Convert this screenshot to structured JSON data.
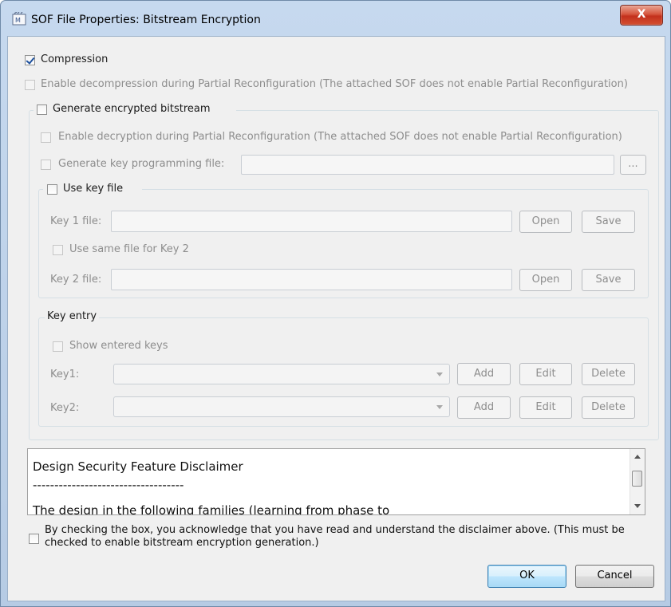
{
  "window": {
    "title": "SOF File Properties: Bitstream Encryption",
    "close_label": "X"
  },
  "compression": {
    "label": "Compression",
    "checked": true
  },
  "enable_decompression": {
    "label": "Enable decompression during Partial Reconfiguration (The attached SOF does not enable Partial Reconfiguration)",
    "checked": false,
    "enabled": false
  },
  "encrypted": {
    "label": "Generate encrypted bitstream",
    "checked": false,
    "enable_decryption_label": "Enable decryption during Partial Reconfiguration (The attached SOF does not enable Partial Reconfiguration)",
    "key_programming_label": "Generate key programming file:",
    "key_programming_value": "",
    "browse_label": "..."
  },
  "key_file": {
    "label": "Use key file",
    "key1_label": "Key 1 file:",
    "key1_value": "",
    "same_file_label": "Use same file for Key 2",
    "key2_label": "Key 2 file:",
    "key2_value": "",
    "open_label": "Open",
    "save_label": "Save"
  },
  "key_entry": {
    "label": "Key entry",
    "show_keys_label": "Show entered keys",
    "key1_label": "Key1:",
    "key2_label": "Key2:",
    "add_label": "Add",
    "edit_label": "Edit",
    "delete_label": "Delete"
  },
  "disclaimer": {
    "title": "Design Security Feature Disclaimer",
    "separator": "-----------------------------------",
    "cut_text": "The design in the following families (learning from phase to"
  },
  "acknowledge": {
    "label": "By checking the box, you acknowledge that you have read and understand the disclaimer above. (This must be checked to enable bitstream encryption generation.)",
    "checked": false
  },
  "footer": {
    "ok_label": "OK",
    "cancel_label": "Cancel"
  }
}
